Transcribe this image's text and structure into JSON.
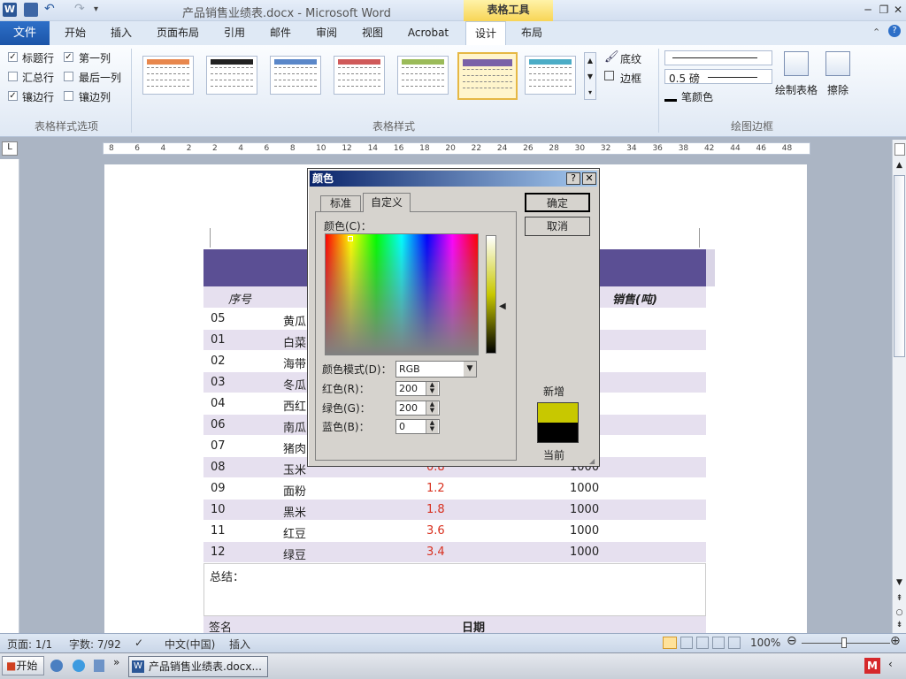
{
  "app": {
    "title": "产品销售业绩表.docx - Microsoft Word",
    "table_tools": "表格工具"
  },
  "tabs": {
    "file": "文件",
    "items": [
      "开始",
      "插入",
      "页面布局",
      "引用",
      "邮件",
      "审阅",
      "视图",
      "Acrobat",
      "设计",
      "布局"
    ],
    "active": "设计"
  },
  "ribbon": {
    "options": [
      {
        "label": "标题行",
        "checked": true
      },
      {
        "label": "第一列",
        "checked": true
      },
      {
        "label": "汇总行",
        "checked": false
      },
      {
        "label": "最后一列",
        "checked": false
      },
      {
        "label": "镶边行",
        "checked": true
      },
      {
        "label": "镶边列",
        "checked": false
      }
    ],
    "group_options": "表格样式选项",
    "group_styles": "表格样式",
    "group_borders": "绘图边框",
    "shading": "底纹",
    "borders": "边框",
    "line_weight": "0.5 磅",
    "pen_color": "笔颜色",
    "draw_table": "绘制表格",
    "eraser": "擦除",
    "swatch_colors": [
      "#e8874d",
      "#222222",
      "#5a87c9",
      "#d05a5a",
      "#9bbb59",
      "#7a62a8",
      "#4bacc6"
    ]
  },
  "ruler": {
    "ticks": [
      "8",
      "6",
      "4",
      "2",
      "2",
      "4",
      "6",
      "8",
      "10",
      "12",
      "14",
      "16",
      "18",
      "20",
      "22",
      "24",
      "26",
      "28",
      "30",
      "32",
      "34",
      "36",
      "38",
      "42",
      "44",
      "46",
      "48"
    ]
  },
  "table": {
    "header_left": "序号",
    "header_right": "销售(吨)",
    "rows": [
      {
        "id": "05",
        "name": "黄瓜",
        "price": "",
        "qty": ""
      },
      {
        "id": "01",
        "name": "白菜",
        "price": "",
        "qty": ""
      },
      {
        "id": "02",
        "name": "海带",
        "price": "",
        "qty": ""
      },
      {
        "id": "03",
        "name": "冬瓜",
        "price": "",
        "qty": ""
      },
      {
        "id": "04",
        "name": "西红",
        "price": "",
        "qty": ""
      },
      {
        "id": "06",
        "name": "南瓜",
        "price": "",
        "qty": ""
      },
      {
        "id": "07",
        "name": "猪肉",
        "price": "",
        "qty": ""
      },
      {
        "id": "08",
        "name": "玉米",
        "price": "0.8",
        "qty": "1000"
      },
      {
        "id": "09",
        "name": "面粉",
        "price": "1.2",
        "qty": "1000"
      },
      {
        "id": "10",
        "name": "黑米",
        "price": "1.8",
        "qty": "1000"
      },
      {
        "id": "11",
        "name": "红豆",
        "price": "3.6",
        "qty": "1000"
      },
      {
        "id": "12",
        "name": "绿豆",
        "price": "3.4",
        "qty": "1000"
      }
    ],
    "summary": "总结：",
    "sign": "签名",
    "date": "日期"
  },
  "dialog": {
    "title": "颜色",
    "tab_standard": "标准",
    "tab_custom": "自定义",
    "colors_label": "颜色(C)：",
    "mode_label": "颜色模式(D)：",
    "mode_value": "RGB",
    "red_label": "红色(R)：",
    "green_label": "绿色(G)：",
    "blue_label": "蓝色(B)：",
    "red": "200",
    "green": "200",
    "blue": "0",
    "ok": "确定",
    "cancel": "取消",
    "new_label": "新增",
    "current_label": "当前",
    "new_color": "#c8c800",
    "current_color": "#000000"
  },
  "status": {
    "page": "页面: 1/1",
    "words": "字数: 7/92",
    "language": "中文(中国)",
    "insert": "插入",
    "zoom": "100%"
  },
  "taskbar": {
    "start": "开始",
    "task": "产品销售业绩表.docx..."
  },
  "colors": {
    "table_header": "#5b4f94",
    "band_row": "#e6e0ef"
  }
}
